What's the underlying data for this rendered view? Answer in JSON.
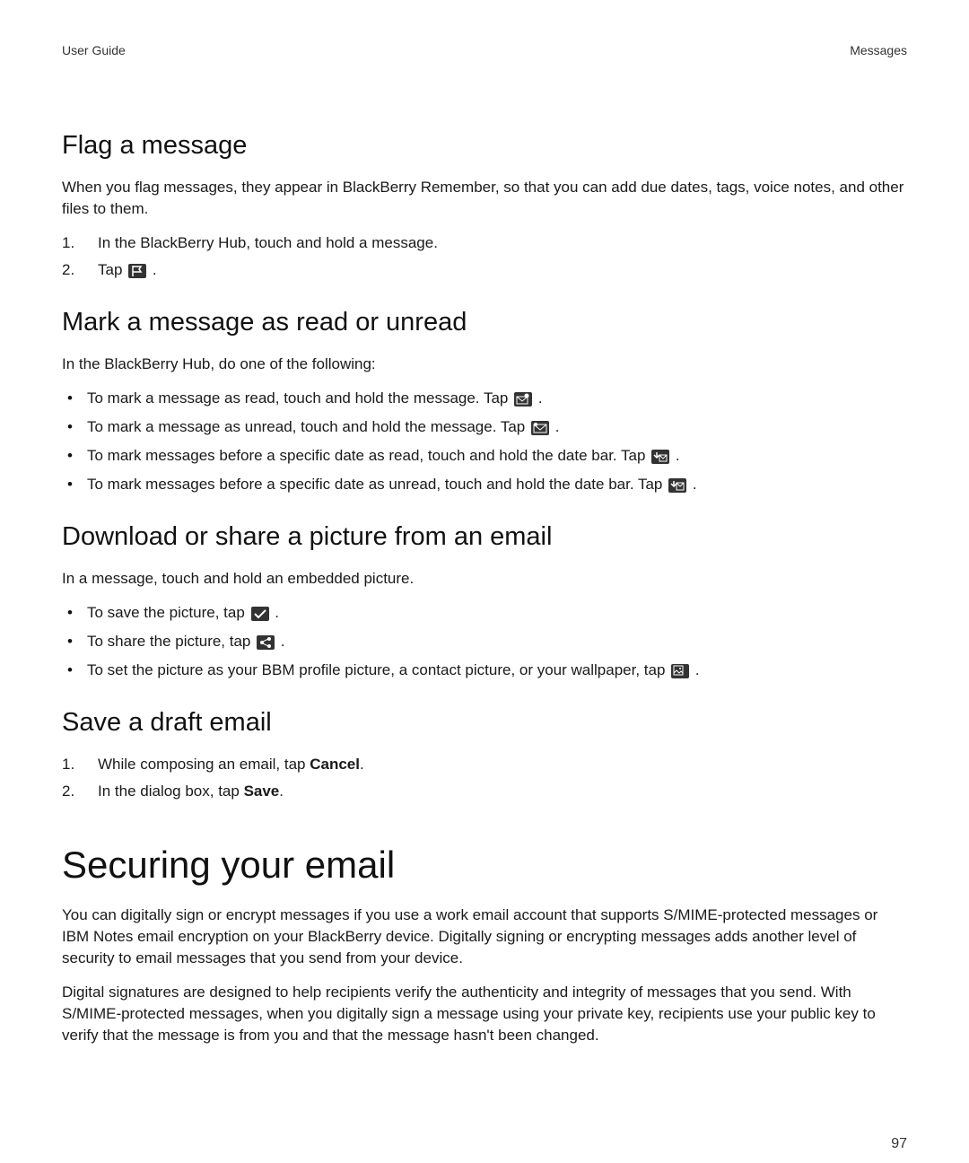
{
  "header": {
    "left": "User Guide",
    "right": "Messages"
  },
  "page_number": "97",
  "flag": {
    "heading": "Flag a message",
    "intro": "When you flag messages, they appear in BlackBerry Remember, so that you can add due dates, tags, voice notes, and other files to them.",
    "steps": {
      "s1": "In the BlackBerry Hub, touch and hold a message.",
      "s2a": "Tap ",
      "s2b": " ."
    }
  },
  "mark": {
    "heading": "Mark a message as read or unread",
    "intro": "In the BlackBerry Hub, do one of the following:",
    "b1a": "To mark a message as read, touch and hold the message. Tap ",
    "b2a": "To mark a message as unread, touch and hold the message. Tap ",
    "b3a": "To mark messages before a specific date as read, touch and hold the date bar. Tap ",
    "b4a": "To mark messages before a specific date as unread, touch and hold the date bar. Tap ",
    "tail": " ."
  },
  "download": {
    "heading": "Download or share a picture from an email",
    "intro": "In a message, touch and hold an embedded picture.",
    "b1a": "To save the picture, tap ",
    "b2a": "To share the picture, tap ",
    "b3a": "To set the picture as your BBM profile picture, a contact picture, or your wallpaper, tap ",
    "tail": " ."
  },
  "draft": {
    "heading": "Save a draft email",
    "s1a": "While composing an email, tap ",
    "s1b": "Cancel",
    "s1c": ".",
    "s2a": "In the dialog box, tap ",
    "s2b": "Save",
    "s2c": "."
  },
  "secure": {
    "heading": "Securing your email",
    "p1": "You can digitally sign or encrypt messages if you use a work email account that supports S/MIME-protected messages or IBM Notes email encryption on your BlackBerry device. Digitally signing or encrypting messages adds another level of security to email messages that you send from your device.",
    "p2": "Digital signatures are designed to help recipients verify the authenticity and integrity of messages that you send. With S/MIME-protected messages, when you digitally sign a message using your private key, recipients use your public key to verify that the message is from you and that the message hasn't been changed."
  }
}
